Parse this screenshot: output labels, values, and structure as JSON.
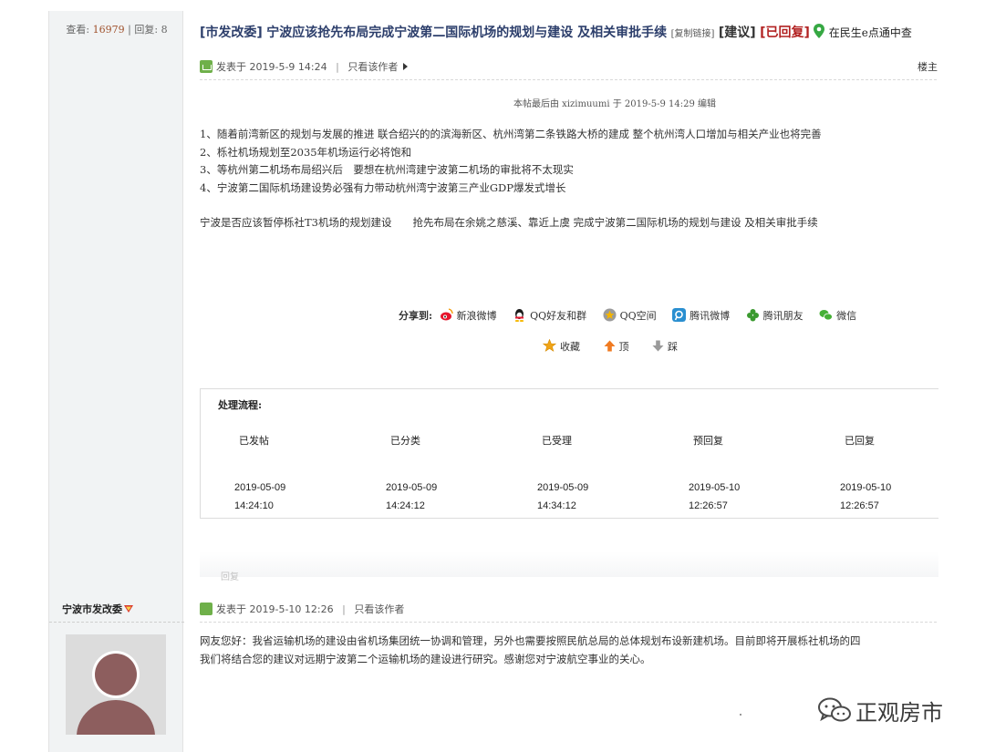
{
  "left": {
    "views_label": "查看:",
    "views": "16979",
    "replies_label": "回复:",
    "replies": "8",
    "reply_author": "宁波市发改委"
  },
  "thread": {
    "tag": "[市发改委]",
    "title": "宁波应该抢先布局完成宁波第二国际机场的规划与建设 及相关审批手续",
    "copy_link": "[复制链接]",
    "category": "[建议]",
    "status": "[已回复]",
    "site": "在民生e点通中查"
  },
  "post": {
    "posted_label": "发表于",
    "posted_time": "2019-5-9 14:24",
    "only_author": "只看该作者",
    "floor": "楼主",
    "edit_note": "本帖最后由 xizimuumi 于 2019-5-9 14:29 编辑",
    "lines": [
      "1、随着前湾新区的规划与发展的推进 联合绍兴的的滨海新区、杭州湾第二条铁路大桥的建成 整个杭州湾人口增加与相关产业也将完善",
      "2、栎社机场规划至2035年机场运行必将饱和",
      "3、等杭州第二机场布局绍兴后　要想在杭州湾建宁波第二机场的审批将不太现实",
      "4、宁波第二国际机场建设势必强有力带动杭州湾宁波第三产业GDP爆发式增长"
    ],
    "summary": "宁波是否应该暂停栎社T3机场的规划建设　　抢先布局在余姚之慈溪、靠近上虞 完成宁波第二国际机场的规划与建设 及相关审批手续"
  },
  "share": {
    "label": "分享到:",
    "items": [
      {
        "label": "新浪微博",
        "icon": "weibo-icon",
        "color": "#e6162d"
      },
      {
        "label": "QQ好友和群",
        "icon": "qq-icon",
        "color": "#1b1b1b"
      },
      {
        "label": "QQ空间",
        "icon": "qzone-icon",
        "color": "#f4b400"
      },
      {
        "label": "腾讯微博",
        "icon": "tencent-weibo-icon",
        "color": "#2a8fd0"
      },
      {
        "label": "腾讯朋友",
        "icon": "tencent-pengyou-icon",
        "color": "#3a9a2f"
      },
      {
        "label": "微信",
        "icon": "wechat-icon",
        "color": "#45b035"
      }
    ]
  },
  "actions": {
    "favorite": "收藏",
    "up": "顶",
    "down": "踩"
  },
  "process": {
    "title": "处理流程:",
    "steps": [
      {
        "name": "已发帖",
        "date": "2019-05-09",
        "time": "14:24:10"
      },
      {
        "name": "已分类",
        "date": "2019-05-09",
        "time": "14:24:12"
      },
      {
        "name": "已受理",
        "date": "2019-05-09",
        "time": "14:34:12"
      },
      {
        "name": "预回复",
        "date": "2019-05-10",
        "time": "12:26:57"
      },
      {
        "name": "已回复",
        "date": "2019-05-10",
        "time": "12:26:57"
      }
    ]
  },
  "reply_link": "回复",
  "reply_post": {
    "posted_label": "发表于",
    "posted_time": "2019-5-10 12:26",
    "only_author": "只看该作者",
    "lines": [
      "网友您好：我省运输机场的建设由省机场集团统一协调和管理，另外也需要按照民航总局的总体规划布设新建机场。目前即将开展栎社机场的四",
      "我们将结合您的建议对远期宁波第二个运输机场的建设进行研究。感谢您对宁波航空事业的关心。"
    ]
  },
  "watermark": "正观房市",
  "colors": {
    "title": "#2c3e6b",
    "replied": "#b22222",
    "views": "#a0522d",
    "left_bg": "#f1f3f4"
  }
}
